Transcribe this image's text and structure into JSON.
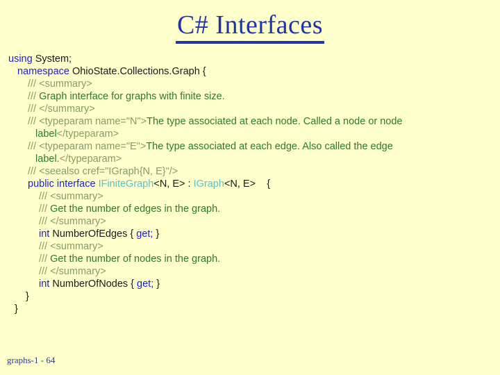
{
  "slide": {
    "title": "C# Interfaces",
    "background_color": "#ffffcc",
    "title_color": "#2233aa",
    "footer": "graphs-1 - 64"
  },
  "colors": {
    "keyword": "#1c23c8",
    "identifier": "#1a1a1a",
    "type_name": "#5fbfbf",
    "comment_tag": "#8a9a6a",
    "comment_text": "#2d7a2d"
  },
  "code": {
    "l1_kw": "using ",
    "l1_rest": "System;",
    "l2_kw": "namespace ",
    "l2_rest": "OhioState.Collections.Graph {",
    "l3": "/// <summary>",
    "l4_tag": "/// ",
    "l4_txt": "Graph interface for graphs with finite size.",
    "l5": "/// </summary>",
    "l6_tag": "/// <typeparam name=\"N\">",
    "l6_txt": "The type associated at each node. Called a node or node",
    "l6_wrap_txt": " label",
    "l6_wrap_tag": "</typeparam>",
    "l7_tag": "/// <typeparam name=\"E\">",
    "l7_txt": "The type associated at each edge. Also called the edge",
    "l7_wrap_txt": " label.",
    "l7_wrap_tag": "</typeparam>",
    "l8": "/// <seealso cref=\"IGraph{N, E}\"/>",
    "l9_kw": "public interface ",
    "l9_type1": "IFiniteGraph",
    "l9_generic1": "<N, E>",
    "l9_colon": " : ",
    "l9_type2": "IGraph",
    "l9_generic2": "<N, E>",
    "l9_brace": "    {",
    "l10": "/// <summary>",
    "l11_tag": "/// ",
    "l11_txt": "Get the number of edges in the graph.",
    "l12": "/// </summary>",
    "l13_kw": "int ",
    "l13_name": "NumberOfEdges { ",
    "l13_kw2": "get;",
    "l13_end": " }",
    "l14": "/// <summary>",
    "l15_tag": "/// ",
    "l15_txt": "Get the number of nodes in the graph.",
    "l16": "/// </summary>",
    "l17_kw": "int ",
    "l17_name": "NumberOfNodes { ",
    "l17_kw2": "get;",
    "l17_end": " }",
    "l18": "}",
    "l19": "}"
  }
}
